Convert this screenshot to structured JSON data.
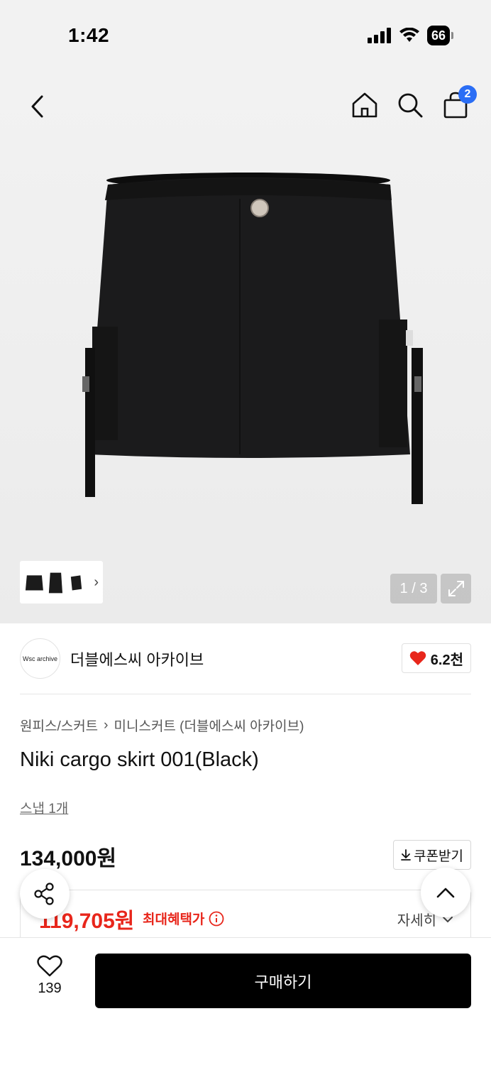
{
  "status_bar": {
    "time": "1:42",
    "battery": "66"
  },
  "nav": {
    "cart_count": "2"
  },
  "gallery": {
    "page_indicator": "1 / 3"
  },
  "brand": {
    "logo_text": "Wsc archive",
    "name": "더블에스씨 아카이브",
    "likes": "6.2천"
  },
  "breadcrumb": {
    "category": "원피스/스커트",
    "subcategory": "미니스커트 (더블에스씨 아카이브)"
  },
  "product": {
    "title": "Niki cargo skirt 001(Black)",
    "snap_link": "스냅 1개",
    "price": "134,000원",
    "coupon_label": "쿠폰받기",
    "benefit_price": "119,705원",
    "benefit_label": "최대혜택가",
    "detail_label": "자세히"
  },
  "bottom_bar": {
    "wish_count": "139",
    "buy_label": "구매하기"
  },
  "colors": {
    "accent_red": "#e8261b",
    "badge_blue": "#2b6ef5",
    "heart_red": "#e8261b"
  }
}
